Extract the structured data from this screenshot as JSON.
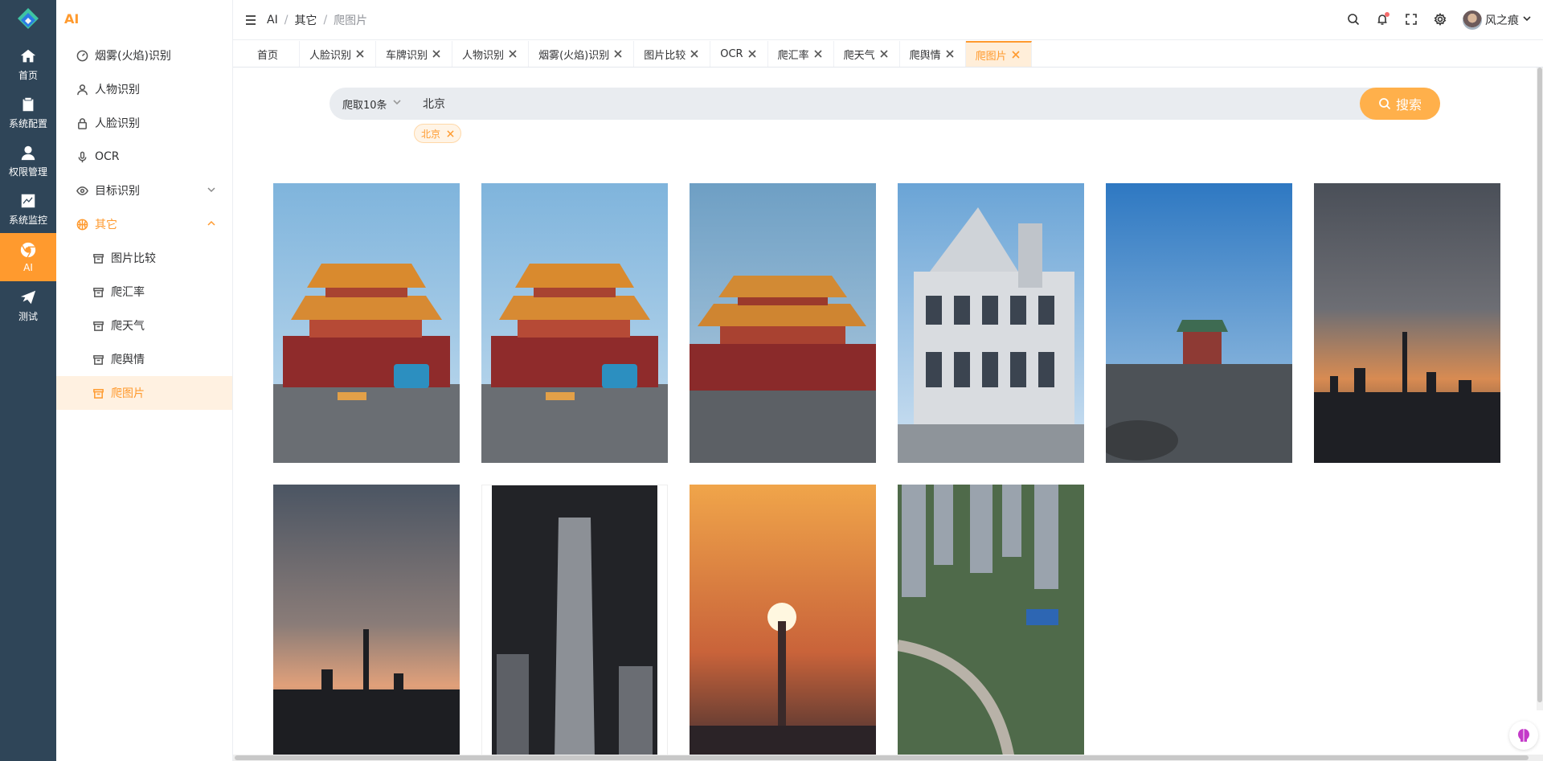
{
  "rail": {
    "items": [
      {
        "label": "首页",
        "icon": "home-icon"
      },
      {
        "label": "系统配置",
        "icon": "clipboard-icon"
      },
      {
        "label": "权限管理",
        "icon": "user-icon"
      },
      {
        "label": "系统监控",
        "icon": "chart-icon"
      },
      {
        "label": "AI",
        "icon": "chrome-icon"
      },
      {
        "label": "测试",
        "icon": "send-icon"
      }
    ]
  },
  "submenu": {
    "title": "AI",
    "items": [
      {
        "label": "烟雾(火焰)识别",
        "icon": "gauge-icon"
      },
      {
        "label": "人物识别",
        "icon": "user-outline-icon"
      },
      {
        "label": "人脸识别",
        "icon": "lock-icon"
      },
      {
        "label": "OCR",
        "icon": "mic-icon"
      },
      {
        "label": "目标识别",
        "icon": "eye-icon"
      },
      {
        "label": "其它",
        "icon": "basketball-icon"
      }
    ],
    "children": [
      {
        "label": "图片比较"
      },
      {
        "label": "爬汇率"
      },
      {
        "label": "爬天气"
      },
      {
        "label": "爬舆情"
      },
      {
        "label": "爬图片"
      }
    ]
  },
  "header": {
    "breadcrumb": [
      "AI",
      "其它",
      "爬图片"
    ],
    "user": "风之痕"
  },
  "tabs": [
    {
      "label": "首页",
      "closable": false
    },
    {
      "label": "人脸识别",
      "closable": true
    },
    {
      "label": "车牌识别",
      "closable": true
    },
    {
      "label": "人物识别",
      "closable": true
    },
    {
      "label": "烟雾(火焰)识别",
      "closable": true
    },
    {
      "label": "图片比较",
      "closable": true
    },
    {
      "label": "OCR",
      "closable": true
    },
    {
      "label": "爬汇率",
      "closable": true
    },
    {
      "label": "爬天气",
      "closable": true
    },
    {
      "label": "爬舆情",
      "closable": true
    },
    {
      "label": "爬图片",
      "closable": true,
      "active": true
    }
  ],
  "search": {
    "count_select": "爬取10条",
    "keyword": "北京",
    "button": "搜索",
    "tag": "北京"
  },
  "colors": {
    "accent": "#ff9a2e",
    "rail_bg": "#2f4558"
  }
}
